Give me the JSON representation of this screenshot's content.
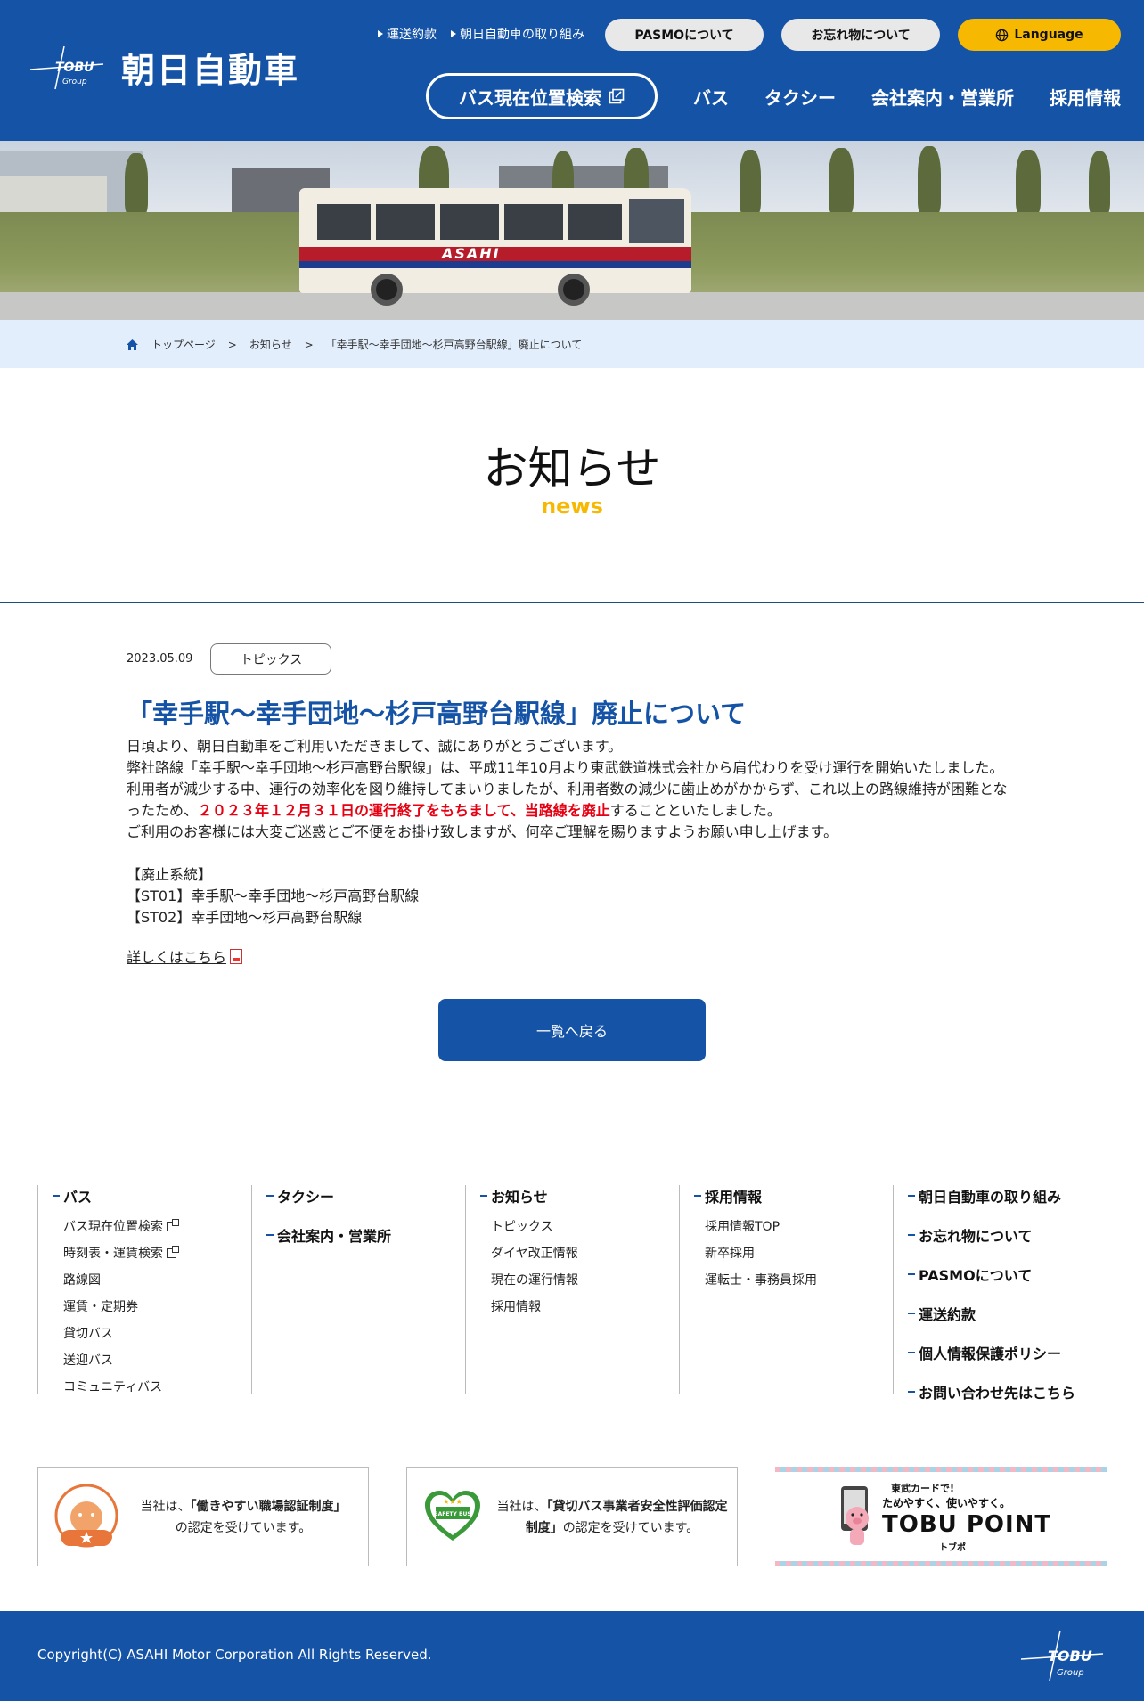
{
  "header": {
    "logo_brand": "TOBU Group",
    "logo_text": "朝日自動車",
    "util_links": [
      "運送約款",
      "朝日自動車の取り組み"
    ],
    "pill_pasmo": "PASMOについて",
    "pill_lost": "お忘れ物について",
    "pill_lang": "Language",
    "bus_search": "バス現在位置検索",
    "nav": [
      "バス",
      "タクシー",
      "会社案内・営業所",
      "採用情報"
    ],
    "colors": {
      "brand": "#1553a6",
      "accent": "#f6b800"
    }
  },
  "hero": {
    "bus_brand": "ASAHI"
  },
  "breadcrumb": {
    "home": "トップページ",
    "sep": ">",
    "level2": "お知らせ",
    "current": "「幸手駅～幸手団地～杉戸高野台駅線」廃止について"
  },
  "page": {
    "title": "お知らせ",
    "subtitle": "news"
  },
  "article": {
    "date": "2023.05.09",
    "category": "トピックス",
    "title": "「幸手駅～幸手団地～杉戸高野台駅線」廃止について",
    "p1": "日頃より、朝日自動車をご利用いただきまして、誠にありがとうございます。",
    "p2a": "弊社路線「幸手駅～幸手団地～杉戸高野台駅線」は、平成11年10月より東武鉄道株式会社から肩代わりを受け運行を開始いたしました。利用者が減少する中、運行の効率化を図り維持してまいりましたが、利用者数の減少に歯止めがかからず、これ以上の路線維持が困難となったため、",
    "p2red": "２０２３年１２月３１日の運行終了をもちまして、当路線を廃止",
    "p2b": "することといたしました。",
    "p3": "ご利用のお客様には大変ご迷惑とご不便をお掛け致しますが、何卒ご理解を賜りますようお願い申し上げます。",
    "list_head": "【廃止系統】",
    "list": [
      "【ST01】幸手駅～幸手団地～杉戸高野台駅線",
      "【ST02】幸手団地～杉戸高野台駅線"
    ],
    "more": "詳しくはこちら",
    "back": "一覧へ戻る"
  },
  "footer_nav": {
    "bus": {
      "head": "バス",
      "items": [
        "バス現在位置検索",
        "時刻表・運賃検索",
        "路線図",
        "運賃・定期券",
        "貸切バス",
        "送迎バス",
        "コミュニティバス"
      ]
    },
    "taxi": {
      "head": "タクシー",
      "head2": "会社案内・営業所"
    },
    "news": {
      "head": "お知らせ",
      "items": [
        "トピックス",
        "ダイヤ改正情報",
        "現在の運行情報",
        "採用情報"
      ]
    },
    "recruit": {
      "head": "採用情報",
      "items": [
        "採用情報TOP",
        "新卒採用",
        "運転士・事務員採用"
      ]
    },
    "others": [
      "朝日自動車の取り組み",
      "お忘れ物について",
      "PASMOについて",
      "運送約款",
      "個人情報保護ポリシー",
      "お問い合わせ先はこちら"
    ]
  },
  "banners": {
    "b1_pre": "当社は、",
    "b1_bold": "「働きやすい職場認証制度」",
    "b1_post": "の認定を受けています。",
    "b2_pre": "当社は、",
    "b2_bold": "「貸切バス事業者安全性評価認定制度」",
    "b2_post": "の認定を受けています。",
    "b2_badge": "SAFETY BUS",
    "b3_small": "東武カードで!",
    "b3_catch": "ためやすく、使いやすく。",
    "b3_title": "TOBU POINT",
    "b3_kana": "トブポ"
  },
  "footer": {
    "copyright": "Copyright(C) ASAHI Motor Corporation All Rights Reserved.",
    "logo_brand": "TOBU Group"
  }
}
